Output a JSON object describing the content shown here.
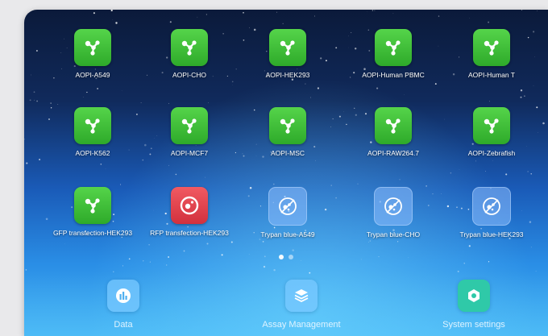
{
  "apps": [
    {
      "label": "AOPI-A549",
      "style": "green",
      "icon": "molecule-icon"
    },
    {
      "label": "AOPI-CHO",
      "style": "green",
      "icon": "molecule-icon"
    },
    {
      "label": "AOPI-HEK293",
      "style": "green",
      "icon": "molecule-icon"
    },
    {
      "label": "AOPI-Human PBMC",
      "style": "green",
      "icon": "molecule-icon"
    },
    {
      "label": "AOPI-Human T",
      "style": "green",
      "icon": "molecule-icon"
    },
    {
      "label": "AOPI-K562",
      "style": "green",
      "icon": "molecule-icon"
    },
    {
      "label": "AOPI-MCF7",
      "style": "green",
      "icon": "molecule-icon"
    },
    {
      "label": "AOPI-MSC",
      "style": "green",
      "icon": "molecule-icon"
    },
    {
      "label": "AOPI-RAW264.7",
      "style": "green",
      "icon": "molecule-icon"
    },
    {
      "label": "AOPI-Zebrafish",
      "style": "green",
      "icon": "molecule-icon"
    },
    {
      "label": "GFP transfection-HEK293",
      "style": "green",
      "icon": "molecule-icon"
    },
    {
      "label": "RFP transfection-HEK293",
      "style": "red",
      "icon": "cell-ring-icon"
    },
    {
      "label": "Trypan blue-A549",
      "style": "blue",
      "icon": "cell-slash-icon"
    },
    {
      "label": "Trypan blue-CHO",
      "style": "blue",
      "icon": "cell-slash-icon"
    },
    {
      "label": "Trypan blue-HEK293",
      "style": "blue",
      "icon": "cell-slash-icon"
    }
  ],
  "dock": [
    {
      "label": "Data",
      "icon": "data-chart-icon"
    },
    {
      "label": "Assay Management",
      "icon": "layers-icon"
    },
    {
      "label": "System settings",
      "icon": "settings-hex-icon"
    }
  ],
  "colors": {
    "green": "#3cbf36",
    "red": "#e0434d",
    "blue_tile": "#8cbeff"
  }
}
